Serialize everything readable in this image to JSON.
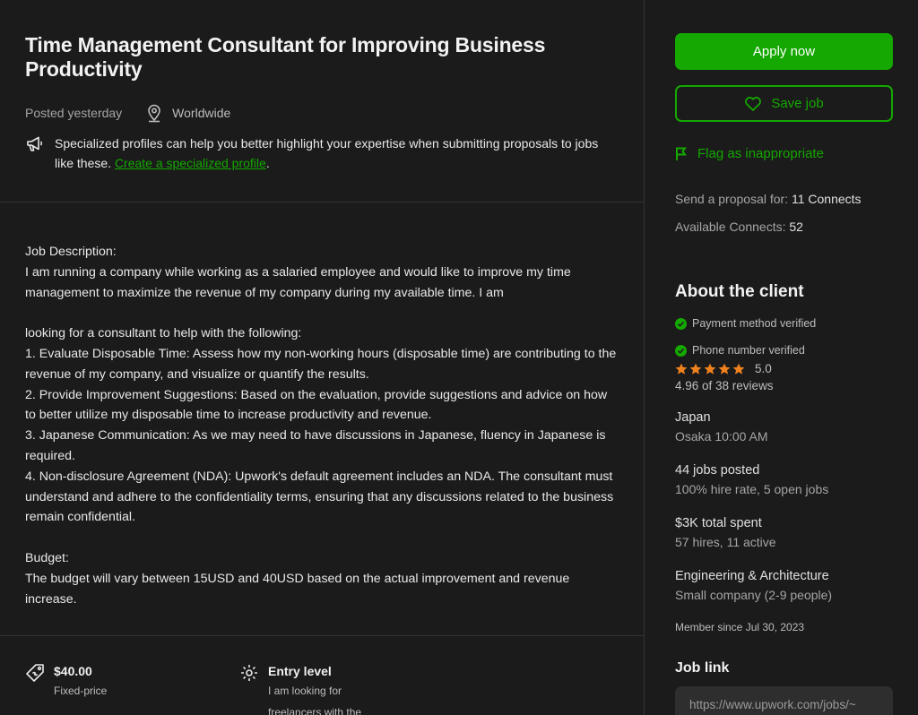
{
  "job": {
    "title": "Time Management Consultant for Improving Business Productivity",
    "posted": "Posted yesterday",
    "location": "Worldwide",
    "specialized_text": "Specialized profiles can help you better highlight your expertise when submitting proposals to jobs like these. ",
    "specialized_link": "Create a specialized profile",
    "specialized_suffix": ".",
    "description": "Job Description:\nI am running a company while working as a salaried employee and would like to improve my time management to maximize the revenue of my company during my available time. I am\n\nlooking for a consultant to help with the following:\n1. Evaluate Disposable Time: Assess how my non-working hours (disposable time) are contributing to the revenue of my company, and visualize or quantify the results.\n2. Provide Improvement Suggestions: Based on the evaluation, provide suggestions and advice on how to better utilize my disposable time to increase productivity and revenue.\n3. Japanese Communication: As we may need to have discussions in Japanese, fluency in Japanese is required.\n4. Non-disclosure Agreement (NDA): Upwork's default agreement includes an NDA. The consultant must understand and adhere to the confidentiality terms, ensuring that any discussions related to the business remain confidential.\n\nBudget:\nThe budget will vary between 15USD and 40USD based on the actual improvement and revenue increase.",
    "price": "$40.00",
    "price_type": "Fixed-price",
    "level": "Entry level",
    "level_desc": "I am looking for",
    "level_desc2": "freelancers with the"
  },
  "sidebar": {
    "apply_label": "Apply now",
    "save_label": "Save job",
    "flag_label": "Flag as inappropriate",
    "send_proposal_label": "Send a proposal for: ",
    "send_proposal_value": "11 Connects",
    "available_label": "Available Connects: ",
    "available_value": "52"
  },
  "client": {
    "title": "About the client",
    "payment_verified": "Payment method verified",
    "phone_verified": "Phone number verified",
    "rating": "5.0",
    "rating_value": 5,
    "reviews": "4.96 of 38 reviews",
    "country": "Japan",
    "city_time": "Osaka 10:00 AM",
    "jobs_posted": "44 jobs posted",
    "hire_rate": "100% hire rate, 5 open jobs",
    "total_spent": "$3K total spent",
    "hires": "57 hires, 11 active",
    "industry": "Engineering & Architecture",
    "company_size": "Small company (2-9 people)",
    "member_since": "Member since Jul 30, 2023",
    "job_link_title": "Job link",
    "job_link_value": "https://www.upwork.com/jobs/~"
  },
  "colors": {
    "accent": "#14a800",
    "background": "#1b1b1b",
    "star": "#f0821e"
  },
  "icons": [
    "location-pin-icon",
    "megaphone-icon",
    "heart-icon",
    "flag-icon",
    "check-circle-icon",
    "star-icon",
    "price-tag-icon",
    "level-gear-icon"
  ]
}
